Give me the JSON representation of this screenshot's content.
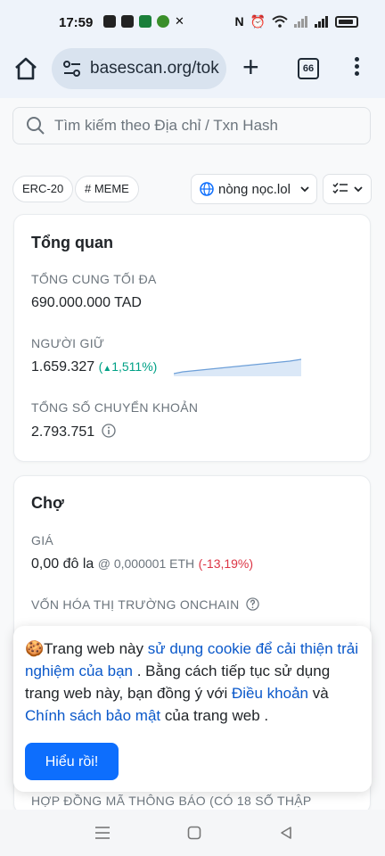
{
  "status_bar": {
    "time": "17:59"
  },
  "browser": {
    "url": "basescan.org/tok",
    "tab_count": "66"
  },
  "search": {
    "placeholder": "Tìm kiếm theo Địa chỉ / Txn Hash"
  },
  "tags": {
    "erc20": "ERC-20",
    "meme": "# MEME"
  },
  "network": {
    "label": "nòng nọc.lol"
  },
  "overview": {
    "title": "Tổng quan",
    "max_supply_label": "TỔNG CUNG TỐI ĐA",
    "max_supply_value": "690.000.000 TAD",
    "holders_label": "NGƯỜI GIỮ",
    "holders_value": "1.659.327",
    "holders_change": "1,511%",
    "transfers_label": "TỔNG SỐ CHUYỂN KHOẢN",
    "transfers_value": "2.793.751"
  },
  "market": {
    "title": "Chợ",
    "price_label": "GIÁ",
    "price_value": "0,00 đô la",
    "price_eth": "@ 0,000001 ETH",
    "price_change": "(-13,19%)",
    "cap_label": "VỐN HÓA THỊ TRƯỜNG ONCHAIN"
  },
  "cookie": {
    "t1": "Trang web này ",
    "l1": "sử dụng cookie để cải thiện trải nghiệm của bạn",
    "t2": " . Bằng cách tiếp tục sử dụng trang web này, bạn đồng ý với ",
    "l2": "Điều khoản",
    "t3": " và ",
    "l3": "Chính sách bảo mật",
    "t4": " của trang web .",
    "button": "Hiểu rồi!"
  },
  "peek": {
    "text": "HỢP ĐỒNG MÃ THÔNG BÁO (CÓ 18 SỐ THẬP"
  },
  "colors": {
    "primary": "#0d6efd",
    "positive": "#00a186",
    "negative": "#dc3545"
  }
}
